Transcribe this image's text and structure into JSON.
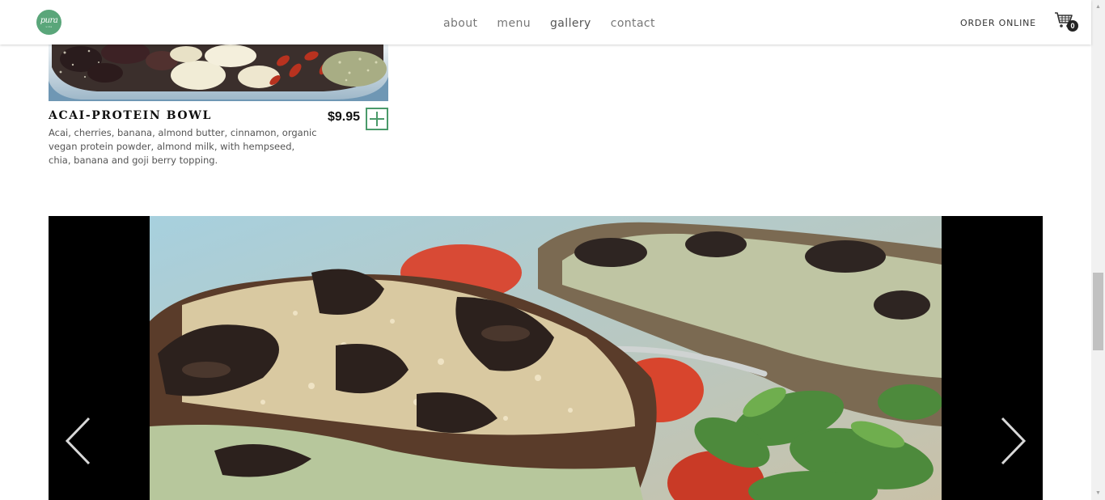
{
  "header": {
    "logo": {
      "text": "pura",
      "subtext": "vida",
      "color": "#5aa67a"
    },
    "nav": [
      {
        "label": "about"
      },
      {
        "label": "menu"
      },
      {
        "label": "gallery"
      },
      {
        "label": "contact"
      }
    ],
    "order_online": "ORDER ONLINE",
    "cart": {
      "icon": "cart-icon",
      "count": "0"
    }
  },
  "menu_item": {
    "title": "ACAI-PROTEIN BOWL",
    "price": "$9.95",
    "description": "Acai, cherries, banana, almond butter, cinnamon, organic vegan protein powder, almond milk, with hempseed, chia, banana and goji berry topping.",
    "add_icon": "plus-icon",
    "accent_color": "#4a9a6a"
  },
  "gallery": {
    "prev_icon": "chevron-left-icon",
    "next_icon": "chevron-right-icon"
  }
}
